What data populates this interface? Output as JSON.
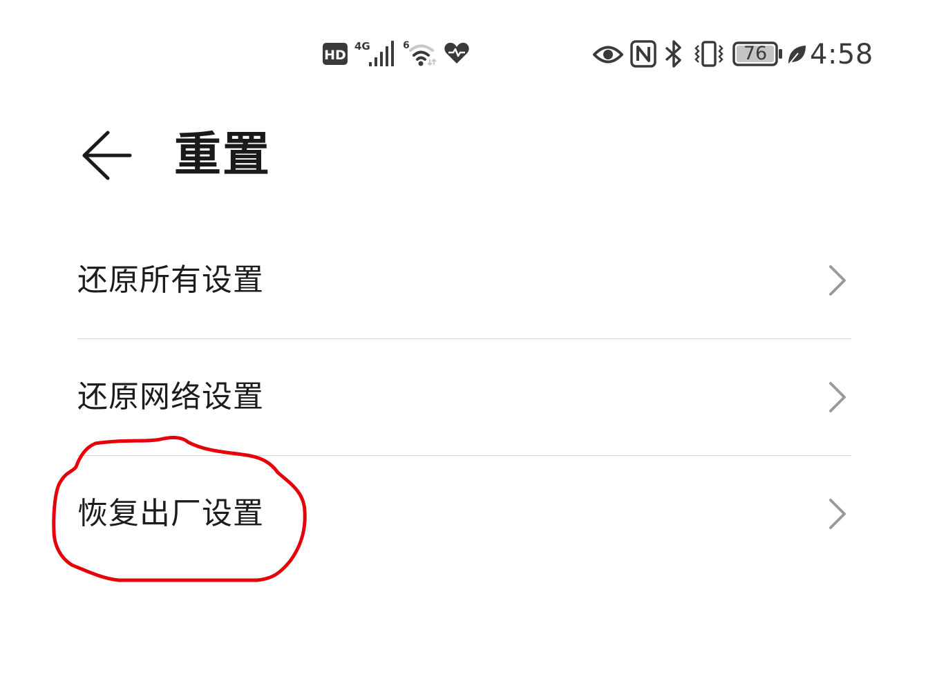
{
  "status_bar": {
    "hd_label": "HD",
    "network_type": "4G",
    "wifi_version": "6",
    "battery_level": "76",
    "time": "4:58",
    "icons": [
      "hd-icon",
      "signal-icon",
      "wifi-icon",
      "health-heart-icon",
      "eye-comfort-icon",
      "nfc-icon",
      "bluetooth-icon",
      "vibrate-icon",
      "battery-icon",
      "power-saving-leaf-icon"
    ]
  },
  "header": {
    "title": "重置",
    "back_icon": "back-arrow-icon"
  },
  "settings": {
    "items": [
      {
        "label": "还原所有设置"
      },
      {
        "label": "还原网络设置"
      },
      {
        "label": "恢复出厂设置"
      }
    ]
  },
  "annotation": {
    "color": "#e5000a"
  },
  "colors": {
    "text_primary": "#1c1c1c",
    "divider": "#d9d9d9",
    "chevron": "#9a9a9a",
    "status_icons": "#3a3a3a"
  }
}
